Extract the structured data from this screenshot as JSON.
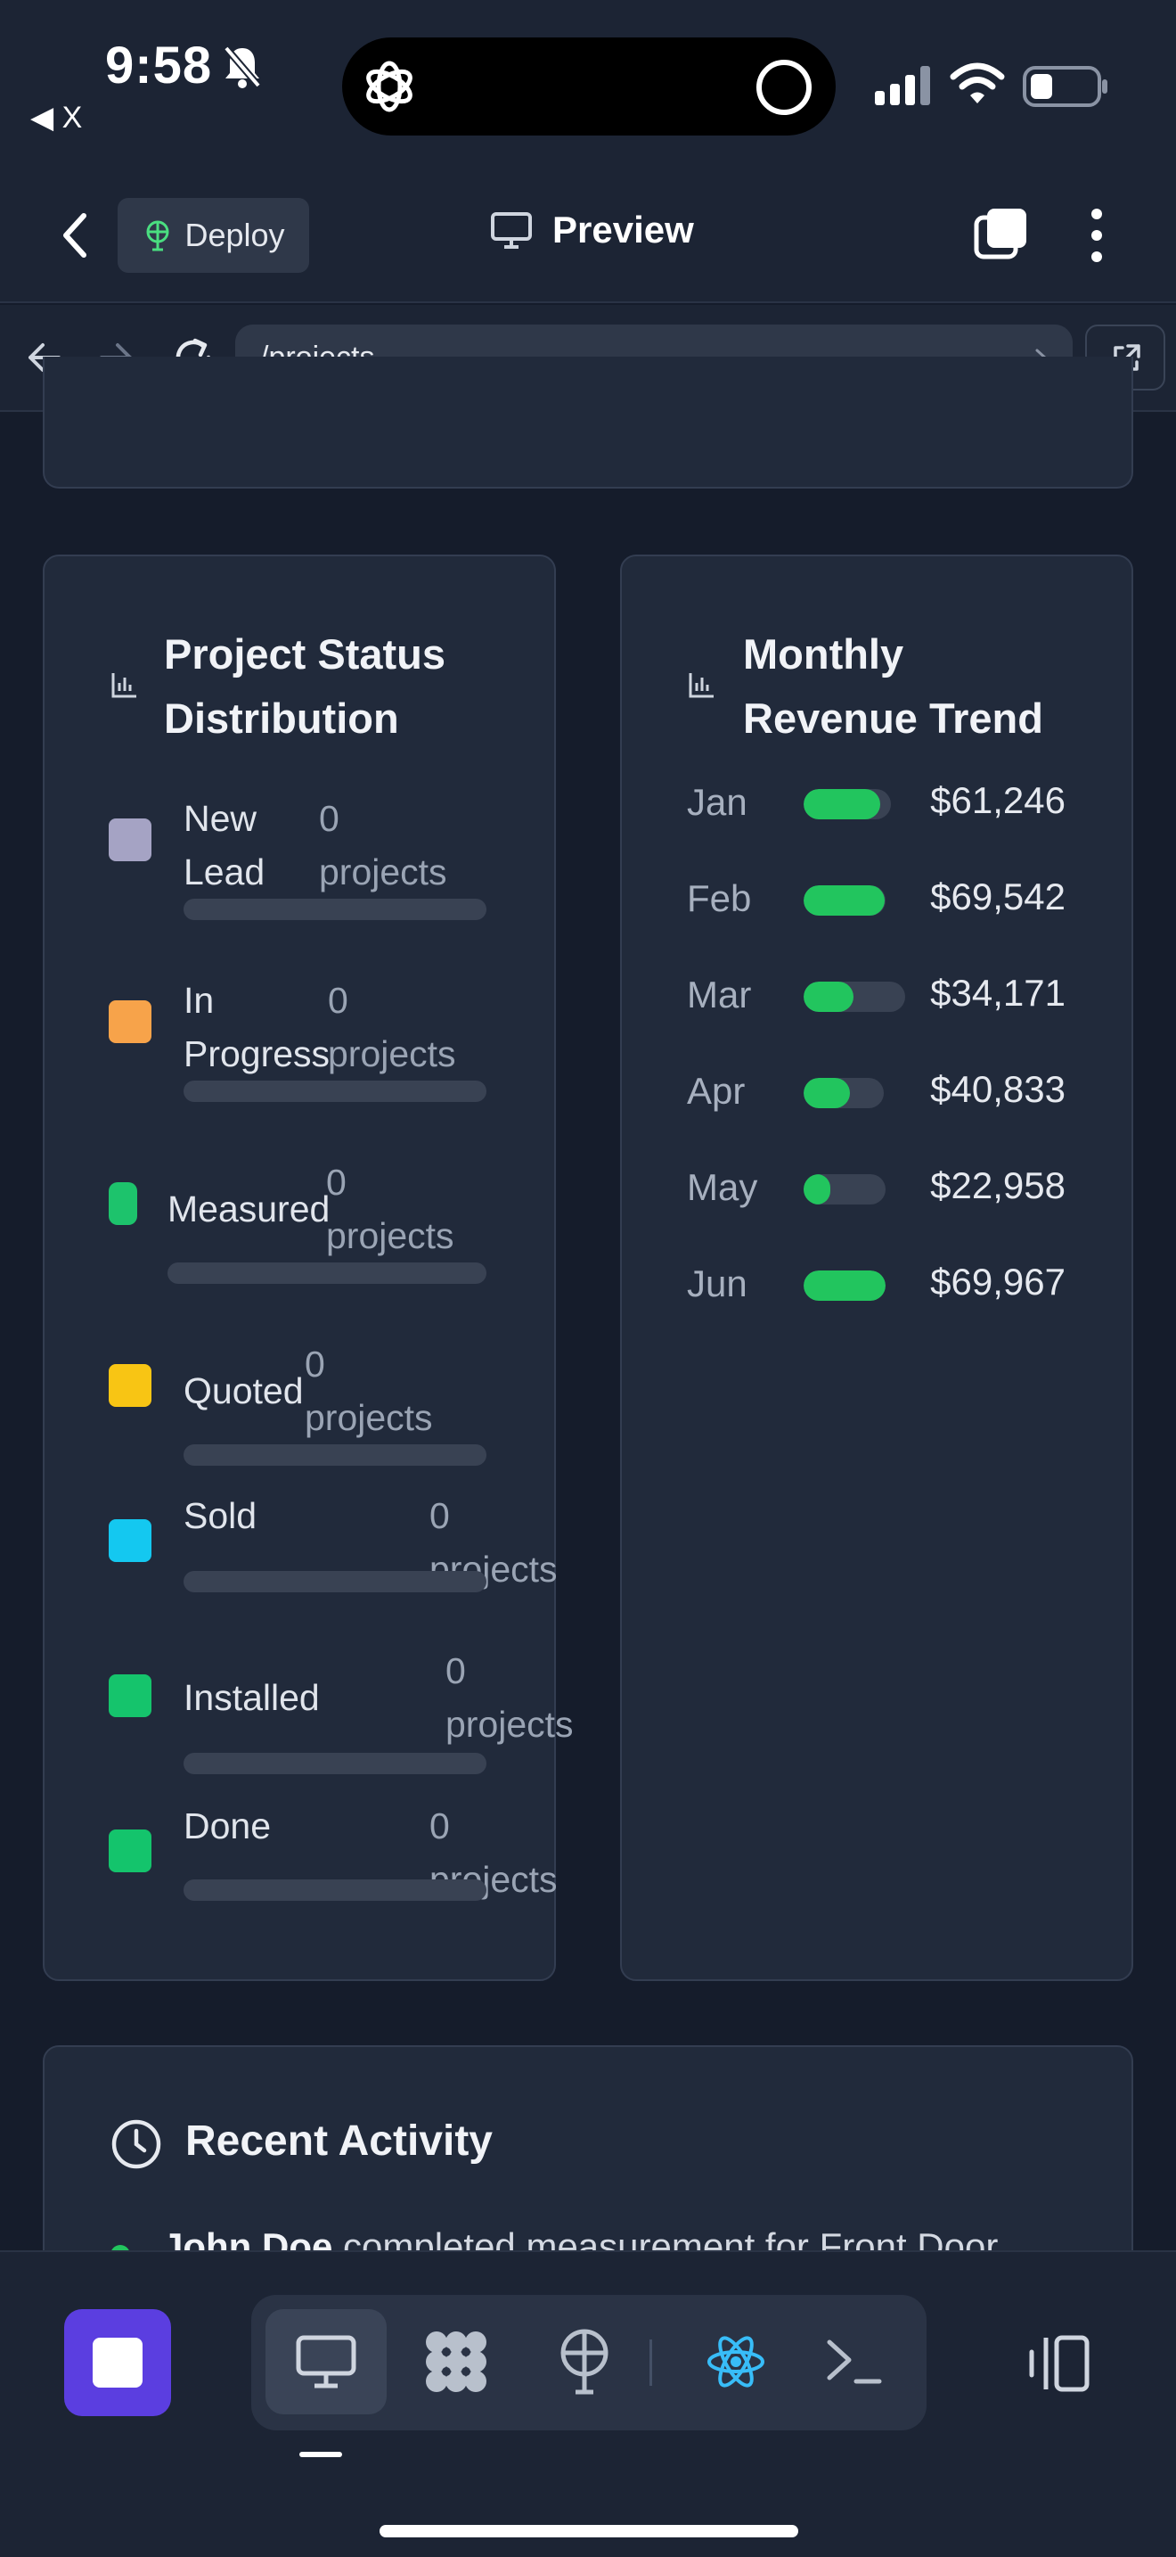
{
  "status_bar": {
    "time": "9:58",
    "back_label": "◀ X"
  },
  "top_nav": {
    "deploy_label": "Deploy",
    "preview_label": "Preview"
  },
  "url_bar": {
    "path": "/projects"
  },
  "status_distribution": {
    "title_line1": "Project Status",
    "title_line2": "Distribution",
    "items": [
      {
        "label_line1": "New",
        "label_line2": "Lead",
        "count_line1": "0",
        "count_line2": "projects",
        "color": "#a5a3c4"
      },
      {
        "label_line1": "In",
        "label_line2": "Progress",
        "count_line1": "0",
        "count_line2": "projects",
        "color": "#f7a34a"
      },
      {
        "label_line1": "Measured",
        "label_line2": "",
        "count_line1": "0",
        "count_line2": "projects",
        "color": "#1dc36c"
      },
      {
        "label_line1": "Quoted",
        "label_line2": "",
        "count_line1": "0",
        "count_line2": "projects",
        "color": "#f8c514"
      },
      {
        "label_line1": "Sold",
        "label_line2": "",
        "count_line1": "0 projects",
        "count_line2": "",
        "color": "#14c8f0"
      },
      {
        "label_line1": "Installed",
        "label_line2": "",
        "count_line1": "0",
        "count_line2": "projects",
        "color": "#15c46c"
      },
      {
        "label_line1": "Done",
        "label_line2": "",
        "count_line1": "0 projects",
        "count_line2": "",
        "color": "#14c46c"
      }
    ]
  },
  "revenue_trend": {
    "title_line1": "Monthly",
    "title_line2": "Revenue Trend",
    "months": [
      {
        "month": "Jan",
        "amount": "$61,246",
        "value": 61246
      },
      {
        "month": "Feb",
        "amount": "$69,542",
        "value": 69542
      },
      {
        "month": "Mar",
        "amount": "$34,171",
        "value": 34171
      },
      {
        "month": "Apr",
        "amount": "$40,833",
        "value": 40833
      },
      {
        "month": "May",
        "amount": "$22,958",
        "value": 22958
      },
      {
        "month": "Jun",
        "amount": "$69,967",
        "value": 69967
      }
    ],
    "bar_color": "#22c55e"
  },
  "recent_activity": {
    "title": "Recent Activity",
    "first_item_name": "John Doe",
    "first_item_text": " completed measurement for Front Door"
  },
  "colors": {
    "background": "#151c2b",
    "card": "#212a3b",
    "accent": "#5b3ee0",
    "react": "#38bdf8"
  }
}
